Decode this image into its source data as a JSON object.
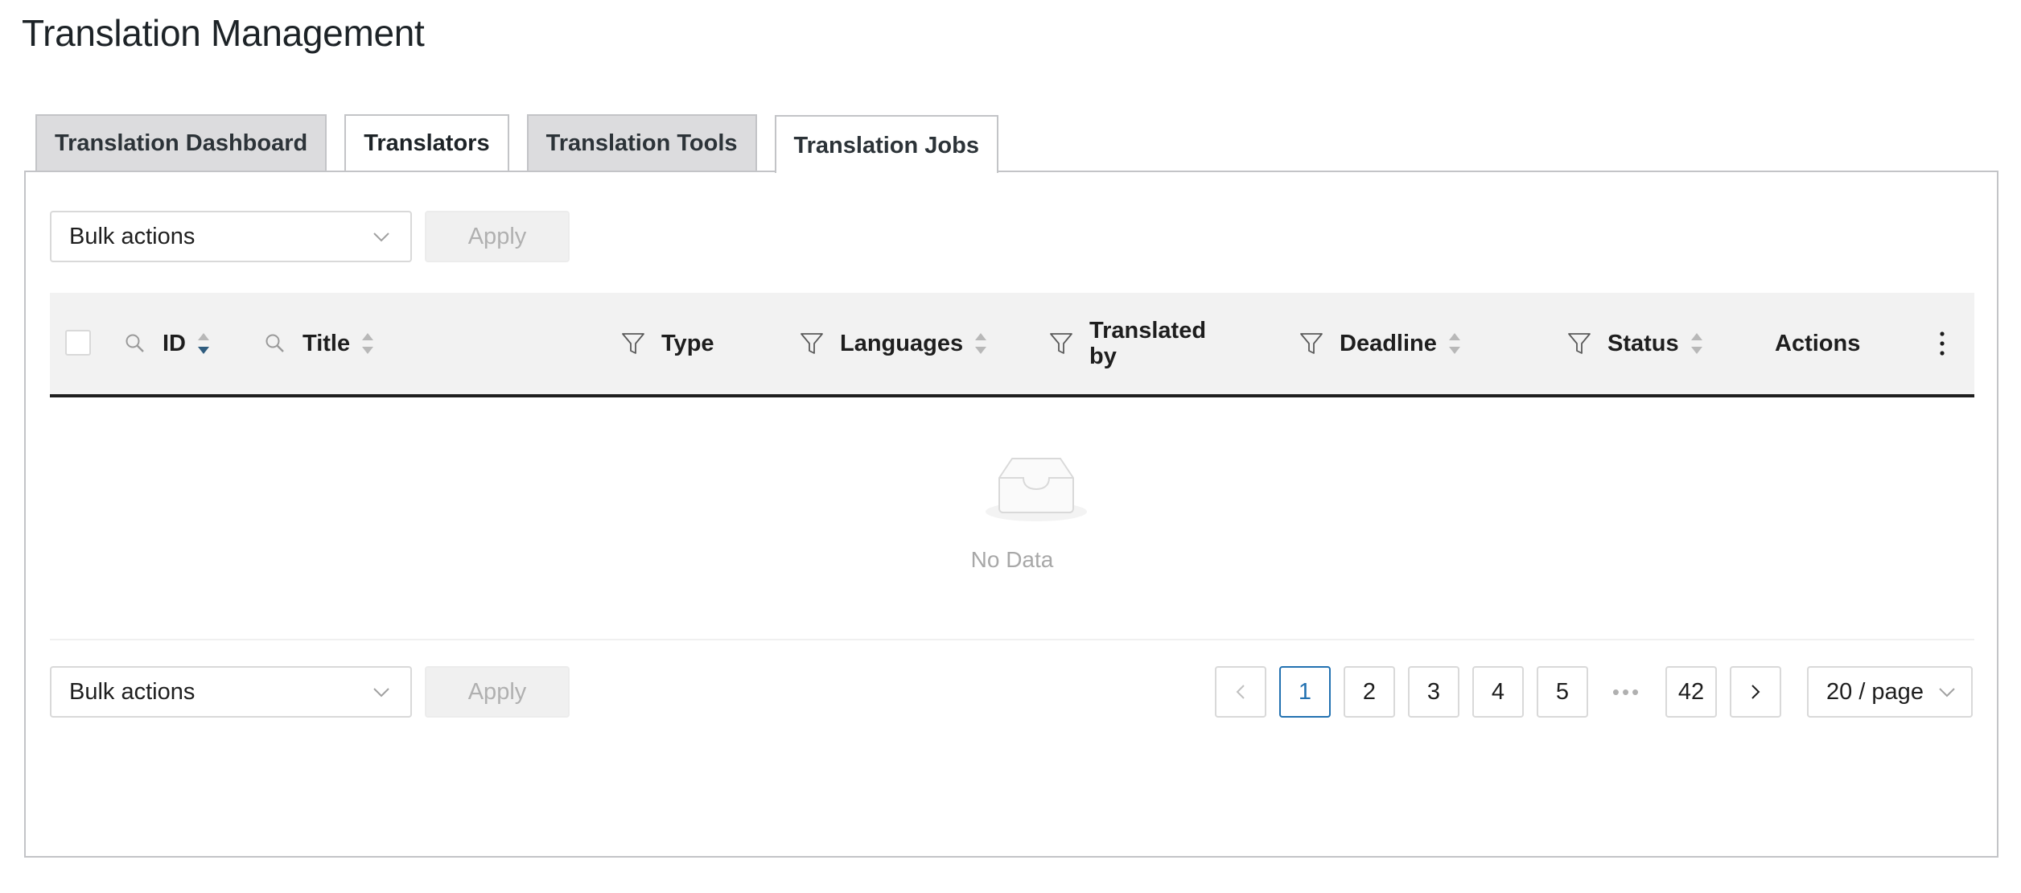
{
  "page": {
    "title": "Translation Management"
  },
  "tabs": [
    {
      "label": "Translation Dashboard",
      "active": false
    },
    {
      "label": "Translators",
      "active": false
    },
    {
      "label": "Translation Tools",
      "active": false
    },
    {
      "label": "Translation Jobs",
      "active": true
    }
  ],
  "bulk_top": {
    "select_value": "Bulk actions",
    "apply_label": "Apply"
  },
  "bulk_bottom": {
    "select_value": "Bulk actions",
    "apply_label": "Apply"
  },
  "table": {
    "columns": {
      "id": "ID",
      "title": "Title",
      "type": "Type",
      "languages": "Languages",
      "translated_by_1": "Translated",
      "translated_by_2": "by",
      "deadline": "Deadline",
      "status": "Status",
      "actions": "Actions"
    },
    "sorted_column": "ID",
    "empty_text": "No Data"
  },
  "pagination": {
    "current_page": "1",
    "pages": [
      "1",
      "2",
      "3",
      "4",
      "5"
    ],
    "ellipsis": "•••",
    "last_page": "42",
    "page_size": "20 / page"
  },
  "colors": {
    "accent": "#2271b1",
    "header_bg": "#f2f2f2",
    "tab_inactive_bg": "#dcdcde"
  },
  "icons": [
    "search-icon",
    "sort-icon",
    "filter-icon",
    "more-vertical-icon",
    "chevron-down-icon",
    "chevron-left-icon",
    "chevron-right-icon",
    "empty-inbox-icon"
  ]
}
